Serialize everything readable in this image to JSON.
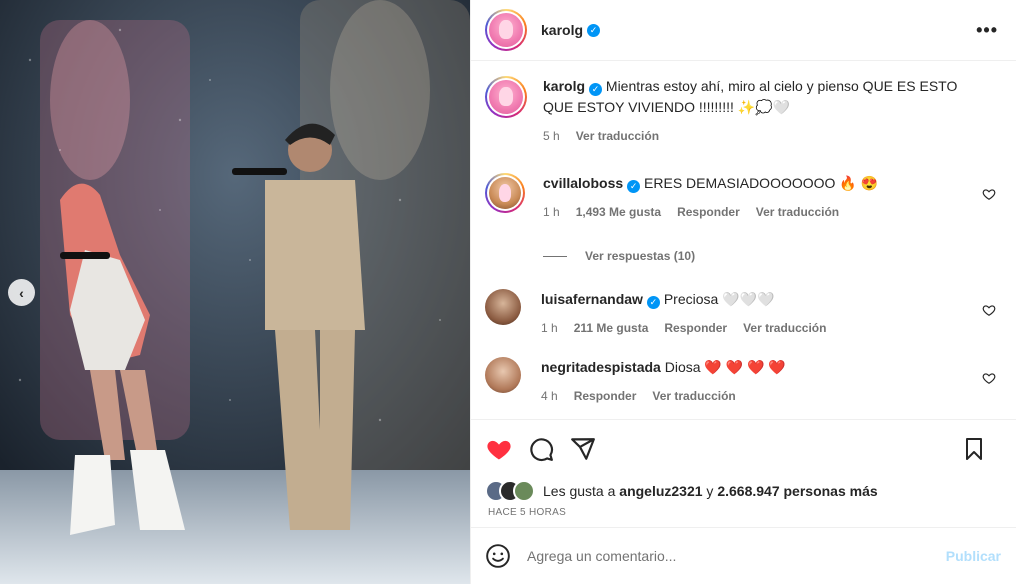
{
  "colors": {
    "accent": "#0095f6",
    "like_red": "#ff3040",
    "muted": "#737373",
    "publish_disabled": "#b2dffc"
  },
  "nav": {
    "prev_icon": "chevron-left-icon",
    "prev_glyph": "‹"
  },
  "header": {
    "username": "karolg",
    "verified_mark": "✓",
    "more_glyph": "•••"
  },
  "caption": {
    "username": "karolg",
    "text": "Mientras estoy ahí, miro al cielo y pienso QUE ES ESTO QUE ESTOY VIVIENDO !!!!!!!!! ✨💭🤍",
    "time": "5 h",
    "translate": "Ver traducción"
  },
  "comments": [
    {
      "username": "cvillaloboss",
      "text": "ERES DEMASIADOOOOOOO 🔥 😍",
      "time": "1 h",
      "likes": "1,493 Me gusta",
      "reply": "Responder",
      "translate": "Ver traducción"
    },
    {
      "username": "luisafernandaw",
      "text": "Preciosa 🤍🤍🤍",
      "time": "1 h",
      "likes": "211 Me gusta",
      "reply": "Responder",
      "translate": "Ver traducción"
    },
    {
      "username": "negritadespistada",
      "text": "Diosa ❤️ ❤️ ❤️ ❤️",
      "time": "4 h",
      "reply": "Responder",
      "translate": "Ver traducción"
    }
  ],
  "replies_link": "Ver respuestas (10)",
  "likes": {
    "prefix": "Les gusta a ",
    "user": "angeluz2321",
    "middle": " y ",
    "count": "2.668.947 personas más"
  },
  "timestamp": "HACE 5 HORAS",
  "composer": {
    "placeholder": "Agrega un comentario...",
    "publish": "Publicar"
  }
}
